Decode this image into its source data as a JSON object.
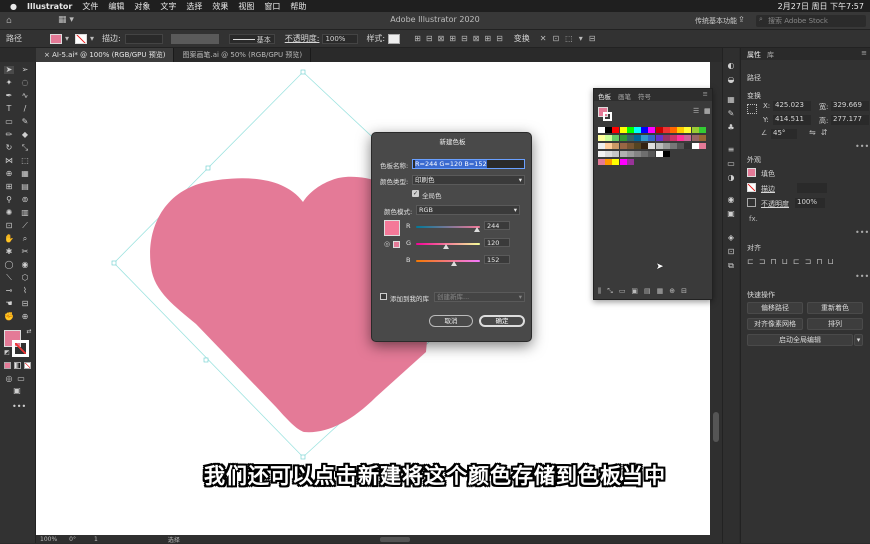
{
  "menubar": {
    "app": "Illustrator",
    "items": [
      "文件",
      "编辑",
      "对象",
      "文字",
      "选择",
      "效果",
      "视图",
      "窗口",
      "帮助"
    ],
    "datetime": "2月27日 周日 下午7:57"
  },
  "titlebar": {
    "title": "Adobe Illustrator 2020",
    "workspace": "传统基本功能",
    "search_placeholder": "搜索 Adobe Stock"
  },
  "controlbar": {
    "label": "路径",
    "stroke_label": "描边:",
    "stroke_style": "基本",
    "opacity_label": "不透明度:",
    "opacity_value": "100%",
    "style_label": "样式:",
    "transform_label": "变换"
  },
  "tabs": [
    {
      "label": "AI-5.ai* @ 100% (RGB/GPU 预览)",
      "active": true
    },
    {
      "label": "图案画笔.ai @ 50% (RGB/GPU 预览)",
      "active": false
    }
  ],
  "statusbar": {
    "zoom": "100%",
    "angle": "0°",
    "artboard": "1",
    "mode": "选择"
  },
  "heart": {
    "fill": "#e47a97"
  },
  "swatches_panel": {
    "tabs": [
      "色板",
      "画笔",
      "符号"
    ],
    "active_tab": "色板"
  },
  "dialog": {
    "title": "新建色板",
    "name_label": "色板名称:",
    "name_value": "R=244 G=120 B=152",
    "type_label": "颜色类型:",
    "type_value": "印刷色",
    "global_label": "全局色",
    "mode_label": "颜色模式:",
    "mode_value": "RGB",
    "r_label": "R",
    "g_label": "G",
    "b_label": "B",
    "r_value": "244",
    "g_value": "120",
    "b_value": "152",
    "r_fraction": 0.957,
    "g_fraction": 0.471,
    "b_fraction": 0.596,
    "library_label": "添加到我的库",
    "library_select": "创建新库...",
    "cancel": "取消",
    "ok": "确定",
    "preview_color": "#f47898"
  },
  "properties": {
    "tabs": [
      "属性",
      "库"
    ],
    "path_label": "路径",
    "transform_label": "变换",
    "x_label": "X:",
    "x_value": "425.023",
    "y_label": "Y:",
    "y_value": "414.511",
    "w_label": "宽:",
    "w_value": "329.669",
    "h_label": "高:",
    "h_value": "277.177",
    "angle": "45°",
    "appearance_label": "外观",
    "fill_label": "填色",
    "stroke_label": "描边",
    "opacity_label": "不透明度",
    "opacity_value": "100%",
    "fx_label": "fx.",
    "align_label": "对齐",
    "quick_label": "快速操作",
    "offset_path": "偏移路径",
    "recolor": "重新着色",
    "pixel_grid": "对齐像素网格",
    "arrange": "排列",
    "global_edit": "启动全局编辑"
  },
  "subtitle": "我们还可以点击新建将这个颜色存储到色板当中"
}
